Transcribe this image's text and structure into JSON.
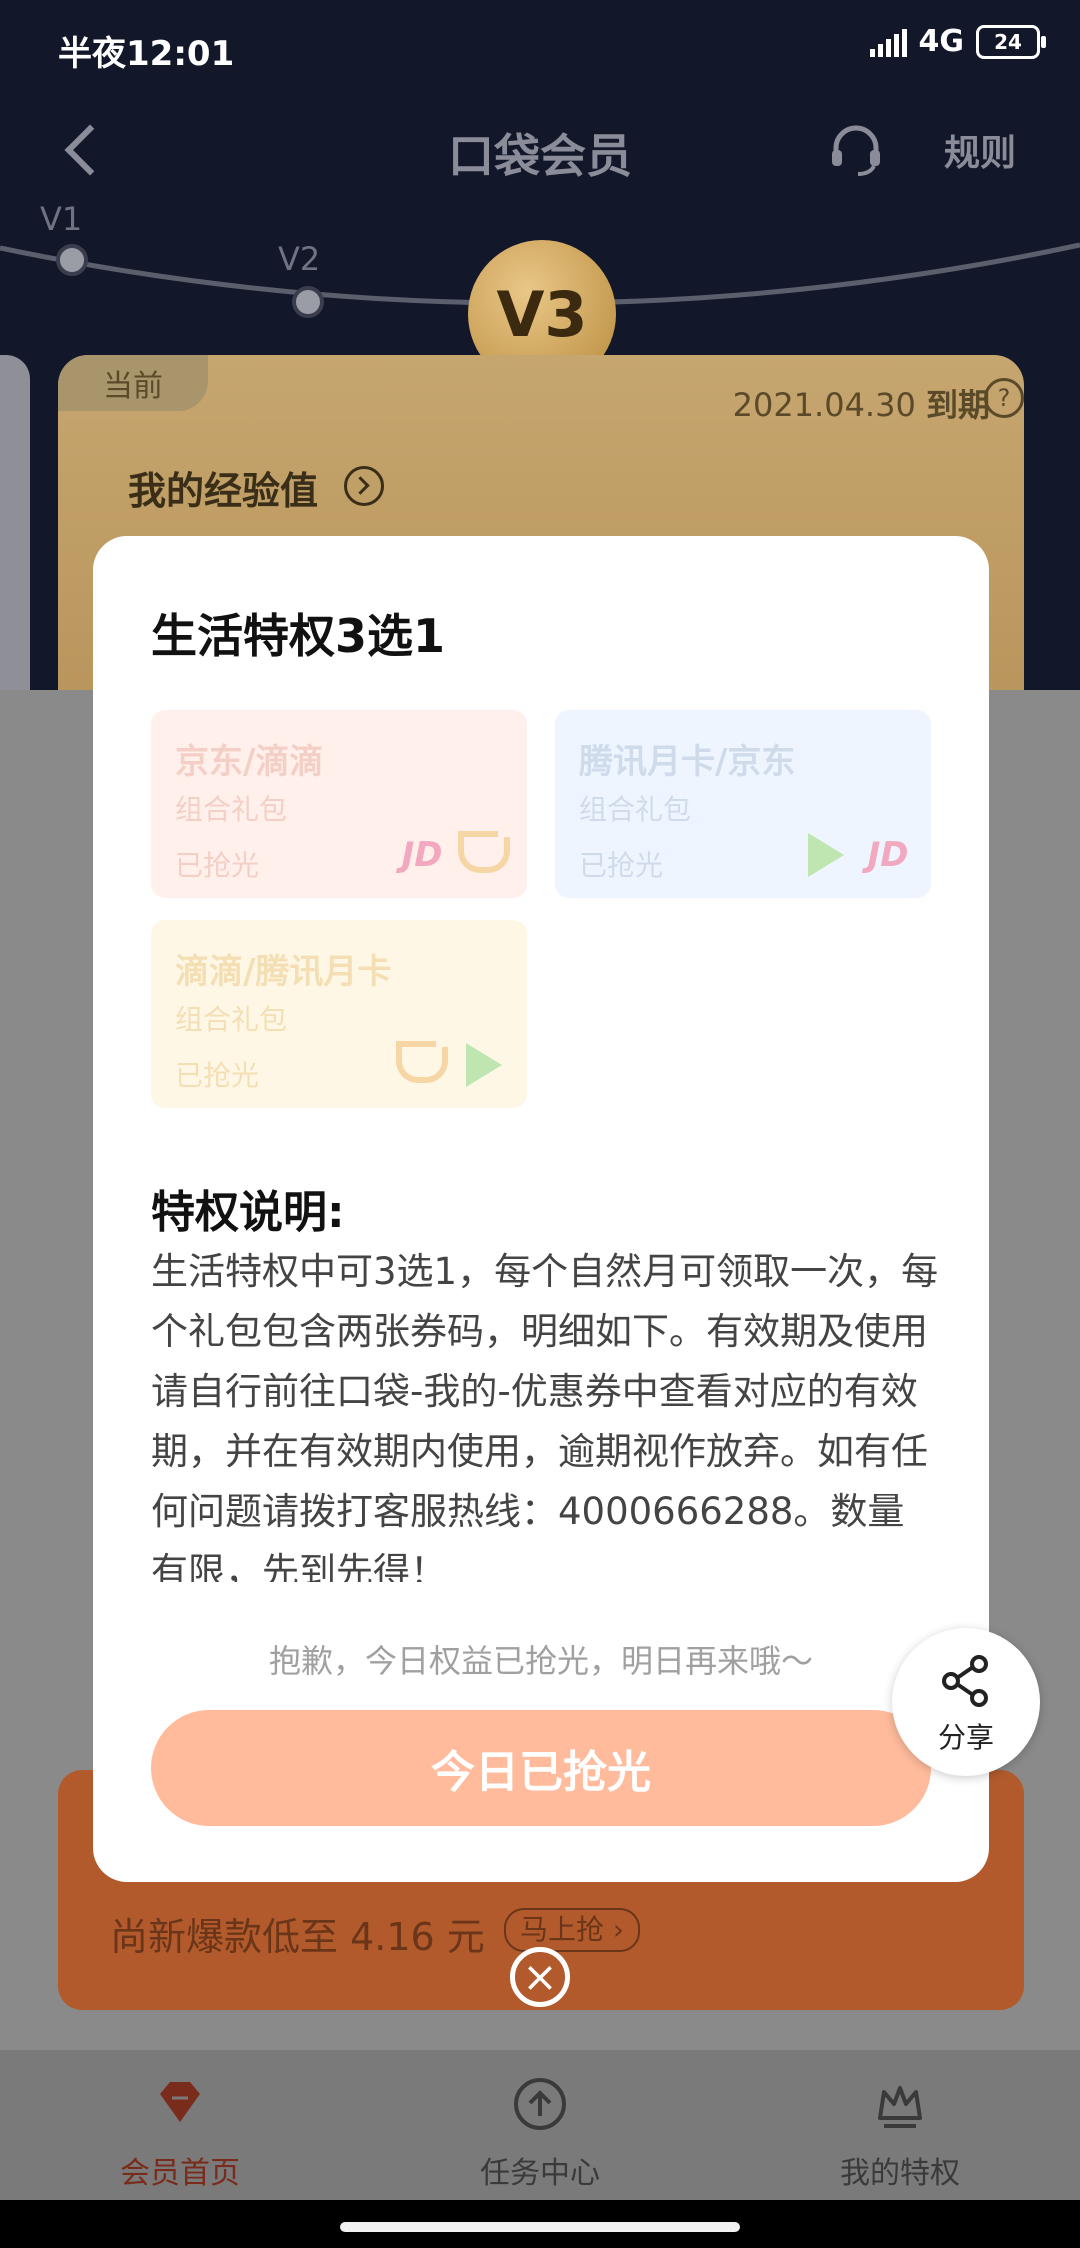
{
  "status_bar": {
    "time": "半夜12:01",
    "network": "4G",
    "battery": "24"
  },
  "header": {
    "title": "口袋会员",
    "rules_label": "规则"
  },
  "levels": {
    "v1": "V1",
    "v2": "V2",
    "current": "V3"
  },
  "member_card": {
    "current_tag": "当前",
    "expiry_date": "2021.04.30",
    "expiry_suffix": "到期",
    "exp_label": "我的经验值"
  },
  "promo": {
    "subtitle": "尚新爆款低至 4.16 元",
    "button": "马上抢 ›"
  },
  "tabbar": {
    "items": [
      {
        "label": "会员首页"
      },
      {
        "label": "任务中心"
      },
      {
        "label": "我的特权"
      }
    ]
  },
  "modal": {
    "title": "生活特权3选1",
    "gifts": [
      {
        "name": "京东/滴滴",
        "sub": "组合礼包",
        "state": "已抢光"
      },
      {
        "name": "腾讯月卡/京东",
        "sub": "组合礼包",
        "state": "已抢光"
      },
      {
        "name": "滴滴/腾讯月卡",
        "sub": "组合礼包",
        "state": "已抢光"
      }
    ],
    "logo_jd": "JD",
    "desc_title": "特权说明:",
    "desc_body": "生活特权中可3选1，每个自然月可领取一次，每个礼包包含两张券码，明细如下。有效期及使用请自行前往口袋-我的-优惠券中查看对应的有效期，并在有效期内使用，逾期视作放弃。如有任何问题请拨打客服热线：4000666288。数量有限，先到先得！",
    "notice": "抱歉，今日权益已抢光，明日再来哦～",
    "cta": "今日已抢光"
  },
  "share": {
    "label": "分享"
  },
  "colors": {
    "cta": "#ffbb9c",
    "hero_bg": "#13172a",
    "accent": "#7a2c1c"
  }
}
